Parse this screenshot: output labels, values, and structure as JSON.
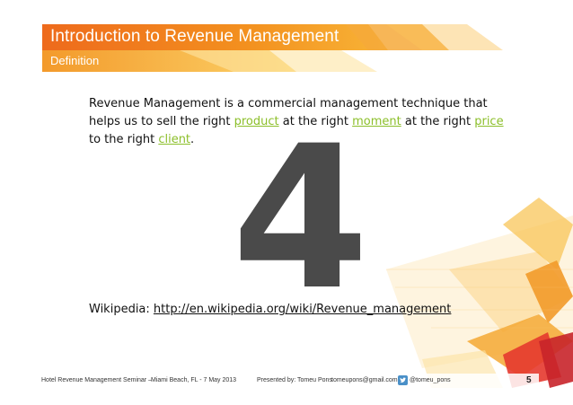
{
  "header": {
    "title": "Introduction to Revenue Management",
    "subtitle": "Definition"
  },
  "body": {
    "definition": {
      "text_1": "Revenue Management is a commercial management technique that helps us to sell the right ",
      "link_product": "product",
      "text_2": " at the right ",
      "link_moment": "moment",
      "text_3": " at the right ",
      "link_price": "price",
      "text_4": " to the right ",
      "link_client": "client",
      "text_5": "."
    },
    "big_number": "4",
    "wikipedia": {
      "label": "Wikipedia: ",
      "url": "http://en.wikipedia.org/wiki/Revenue_management"
    }
  },
  "footer": {
    "seminar": "Hotel Revenue Management Seminar  –",
    "location": "Miami Beach, FL  -  7 May 2013",
    "presented": "Presented by:  Tomeu Pons",
    "email": "tomeupons@gmail.com",
    "twitter_icon": "twitter-bird-icon",
    "handle": "@tomeu_pons",
    "page": "5"
  },
  "colors": {
    "orange": "#f07d1a",
    "yellow": "#fbbd2c",
    "red": "#e5392d",
    "link_green": "#8cbf2a"
  }
}
